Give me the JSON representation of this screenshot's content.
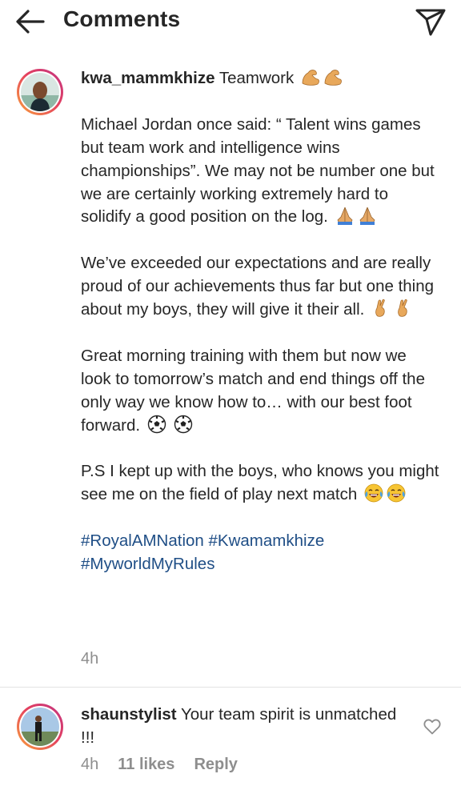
{
  "header": {
    "title": "Comments"
  },
  "post": {
    "username": "kwa_mammkhize",
    "caption_first_line": "Teamwork",
    "paragraphs": [
      "Michael Jordan once said: “ Talent wins games but team work and intelligence wins championships”. We may not be number one but we are certainly working extremely hard to solidify a good position on the log.",
      "We’ve exceeded our expectations and are really proud of our achievements thus far but one thing about my boys, they will give it their all.",
      "Great morning training with them  but now we look to tomorrow’s match and end things off the only way we know how to… with our best foot forward.",
      "P.S I kept up with the boys, who knows you might see me on the field of play next match"
    ],
    "hashtags": [
      "#RoyalAMNation",
      "#Kwamamkhize",
      "#MyworldMyRules"
    ],
    "time": "4h"
  },
  "comment": {
    "username": "shaunstylist",
    "text": "Your team spirit is unmatched !!!",
    "time": "4h",
    "likes": "11 likes",
    "reply_label": "Reply"
  },
  "icons": {
    "back": "arrow-left-icon",
    "send": "paper-plane-icon",
    "like": "heart-outline-icon",
    "emoji_muscle": "flexed-biceps-emoji",
    "emoji_pray": "folded-hands-emoji",
    "emoji_crossed": "crossed-fingers-emoji",
    "emoji_ball": "soccer-ball-emoji",
    "emoji_laugh": "tears-of-joy-emoji"
  },
  "colors": {
    "hashtag": "#1f4e86",
    "meta": "#8e8e8e",
    "text": "#262626",
    "ring_start": "#f9a23b",
    "ring_end": "#c13584"
  }
}
